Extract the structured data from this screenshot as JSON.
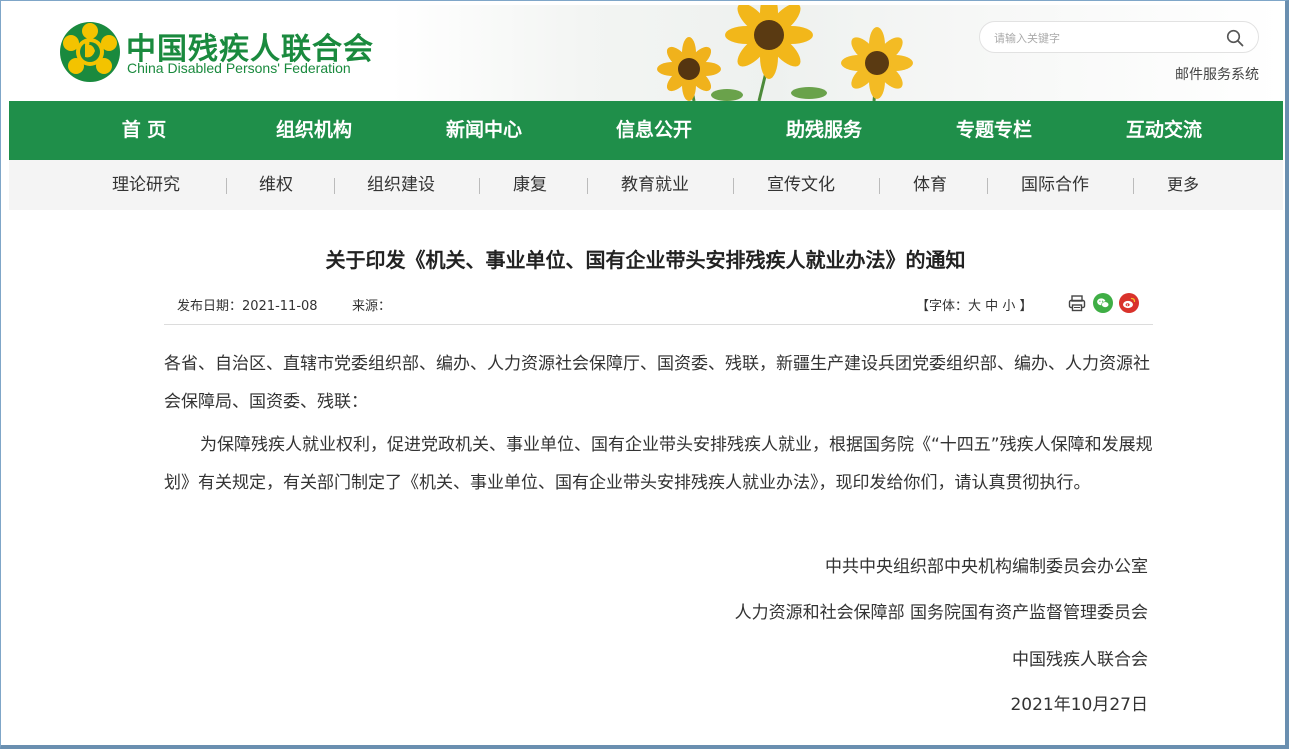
{
  "header": {
    "logo_cn": "中国残疾人联合会",
    "logo_en": "China Disabled Persons' Federation",
    "search_placeholder": "请输入关键字",
    "mail_link": "邮件服务系统"
  },
  "main_nav": [
    "首 页",
    "组织机构",
    "新闻中心",
    "信息公开",
    "助残服务",
    "专题专栏",
    "互动交流"
  ],
  "sub_nav": [
    "理论研究",
    "维权",
    "组织建设",
    "康复",
    "教育就业",
    "宣传文化",
    "体育",
    "国际合作",
    "更多"
  ],
  "article": {
    "title": "关于印发《机关、事业单位、国有企业带头安排残疾人就业办法》的通知",
    "date_label": "发布日期：2021-11-08",
    "source_label": "来源：",
    "font_size_prefix": "【字体：",
    "font_large": "大",
    "font_medium": "中",
    "font_small": "小",
    "font_size_suffix": "】",
    "paragraph1": "各省、自治区、直辖市党委组织部、编办、人力资源社会保障厅、国资委、残联，新疆生产建设兵团党委组织部、编办、人力资源社会保障局、国资委、残联：",
    "paragraph2": "为保障残疾人就业权利，促进党政机关、事业单位、国有企业带头安排残疾人就业，根据国务院《“十四五”残疾人保障和发展规划》有关规定，有关部门制定了《机关、事业单位、国有企业带头安排残疾人就业办法》，现印发给你们，请认真贯彻执行。",
    "signature1": "中共中央组织部中央机构编制委员会办公室",
    "signature2": "人力资源和社会保障部 国务院国有资产监督管理委员会",
    "signature3": "中国残疾人联合会",
    "signature_date": "2021年10月27日"
  },
  "icons": {
    "print": "print-icon",
    "wechat": "wechat-icon",
    "weibo": "weibo-icon",
    "search": "search-icon"
  },
  "colors": {
    "brand_green": "#1f8f4a",
    "logo_yellow": "#f3c300",
    "wechat_green": "#3fae45",
    "weibo_red": "#d9322b"
  }
}
